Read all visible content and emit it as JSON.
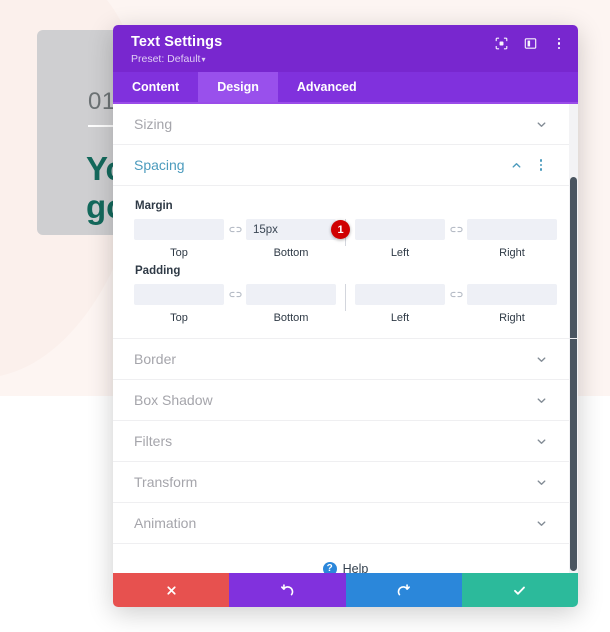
{
  "background": {
    "card_number": "01",
    "card_heading": "Yo\ngo"
  },
  "modal": {
    "title": "Text Settings",
    "preset_label": "Preset: Default",
    "preset_caret": "▾",
    "header_icons": [
      {
        "name": "responsive-preview-icon",
        "title": "Responsive Preview"
      },
      {
        "name": "layout-columns-icon",
        "title": "Layout"
      },
      {
        "name": "more-options-icon",
        "title": "More Options"
      }
    ],
    "tabs": [
      {
        "label": "Content",
        "active": false
      },
      {
        "label": "Design",
        "active": true
      },
      {
        "label": "Advanced",
        "active": false
      }
    ],
    "sections": [
      {
        "label": "Sizing",
        "open": false
      },
      {
        "label": "Spacing",
        "open": true
      },
      {
        "label": "Border",
        "open": false
      },
      {
        "label": "Box Shadow",
        "open": false
      },
      {
        "label": "Filters",
        "open": false
      },
      {
        "label": "Transform",
        "open": false
      },
      {
        "label": "Animation",
        "open": false
      }
    ],
    "spacing": {
      "margin": {
        "group_label": "Margin",
        "fields": [
          {
            "sub_label": "Top",
            "value": "",
            "placeholder": ""
          },
          {
            "sub_label": "Bottom",
            "value": "15px",
            "placeholder": ""
          },
          {
            "sub_label": "Left",
            "value": "",
            "placeholder": ""
          },
          {
            "sub_label": "Right",
            "value": "",
            "placeholder": ""
          }
        ],
        "badge": "1"
      },
      "padding": {
        "group_label": "Padding",
        "fields": [
          {
            "sub_label": "Top",
            "value": "",
            "placeholder": ""
          },
          {
            "sub_label": "Bottom",
            "value": "",
            "placeholder": ""
          },
          {
            "sub_label": "Left",
            "value": "",
            "placeholder": ""
          },
          {
            "sub_label": "Right",
            "value": "",
            "placeholder": ""
          }
        ]
      }
    },
    "help": {
      "icon_char": "?",
      "label": "Help"
    },
    "footer_buttons": [
      {
        "name": "cancel-button",
        "icon": "close-icon",
        "color": "#e7514f"
      },
      {
        "name": "undo-button",
        "icon": "undo-icon",
        "color": "#8131dd"
      },
      {
        "name": "redo-button",
        "icon": "redo-icon",
        "color": "#2b87da"
      },
      {
        "name": "save-button",
        "icon": "check-icon",
        "color": "#2cba9b"
      }
    ]
  },
  "colors": {
    "header_purple": "#7827cf",
    "tabs_purple": "#8031dd",
    "tab_active_purple": "#9950ec",
    "section_open_teal": "#4c9bbd",
    "badge_red": "#d00000",
    "hero_bg": "#fdf5f2",
    "heading_teal": "#14695c"
  }
}
